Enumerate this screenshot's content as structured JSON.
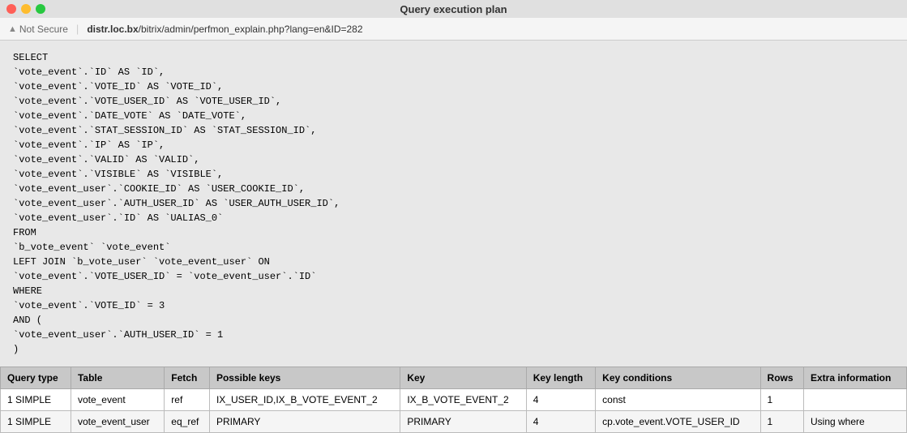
{
  "titleBar": {
    "title": "Query execution plan",
    "trafficLights": [
      "close",
      "minimize",
      "maximize"
    ]
  },
  "addressBar": {
    "notSecureLabel": "Not Secure",
    "url": {
      "domain": "distr.loc.bx",
      "path": "/bitrix/admin/perfmon_explain.php?lang=en&ID=282"
    }
  },
  "sql": {
    "lines": [
      "SELECT",
      "  `vote_event`.`ID` AS `ID`,",
      "  `vote_event`.`VOTE_ID` AS `VOTE_ID`,",
      "  `vote_event`.`VOTE_USER_ID` AS `VOTE_USER_ID`,",
      "  `vote_event`.`DATE_VOTE` AS `DATE_VOTE`,",
      "  `vote_event`.`STAT_SESSION_ID` AS `STAT_SESSION_ID`,",
      "  `vote_event`.`IP` AS `IP`,",
      "  `vote_event`.`VALID` AS `VALID`,",
      "  `vote_event`.`VISIBLE` AS `VISIBLE`,",
      "  `vote_event_user`.`COOKIE_ID` AS `USER_COOKIE_ID`,",
      "  `vote_event_user`.`AUTH_USER_ID` AS `USER_AUTH_USER_ID`,",
      "  `vote_event_user`.`ID` AS `UALIAS_0`",
      "FROM",
      "  `b_vote_event` `vote_event`",
      "  LEFT JOIN `b_vote_user` `vote_event_user` ON",
      "    `vote_event`.`VOTE_USER_ID` = `vote_event_user`.`ID`",
      "WHERE",
      "  `vote_event`.`VOTE_ID` = 3",
      "  AND (",
      "    `vote_event_user`.`AUTH_USER_ID` = 1",
      "  )"
    ]
  },
  "table": {
    "headers": [
      "Query type",
      "Table",
      "Fetch",
      "Possible keys",
      "Key",
      "Key length",
      "Key conditions",
      "Rows",
      "Extra information"
    ],
    "rows": [
      {
        "queryType": "1 SIMPLE",
        "table": "vote_event",
        "fetch": "ref",
        "possibleKeys": "IX_USER_ID,IX_B_VOTE_EVENT_2",
        "key": "IX_B_VOTE_EVENT_2",
        "keyLength": "4",
        "keyConditions": "const",
        "rows": "1",
        "extraInformation": ""
      },
      {
        "queryType": "1 SIMPLE",
        "table": "vote_event_user",
        "fetch": "eq_ref",
        "possibleKeys": "PRIMARY",
        "key": "PRIMARY",
        "keyLength": "4",
        "keyConditions": "cp.vote_event.VOTE_USER_ID",
        "rows": "1",
        "extraInformation": "Using where"
      }
    ]
  }
}
